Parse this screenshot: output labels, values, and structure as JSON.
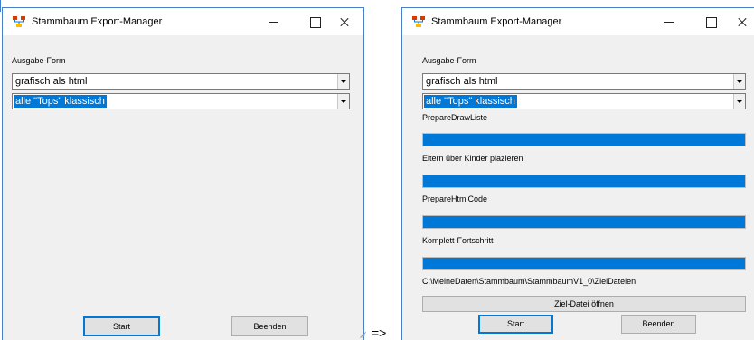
{
  "transition": {
    "arrow": "=>"
  },
  "colors": {
    "accent": "#0078d7",
    "window_border": "#4a7fc8",
    "titlebar": "#ffffff",
    "client": "#f0f0f0"
  },
  "icons": {
    "app": "family-tree-app-icon",
    "minimize": "minimize-icon",
    "maximize": "maximize-icon",
    "close": "close-icon",
    "dropdown": "chevron-down-icon",
    "grip": "resize-grip-icon"
  },
  "left": {
    "title": "Stammbaum Export-Manager",
    "output_label": "Ausgabe-Form",
    "combo_format": {
      "value": "grafisch als html"
    },
    "combo_tops": {
      "value": "alle \"Tops\" klassisch"
    },
    "start_label": "Start",
    "quit_label": "Beenden"
  },
  "right": {
    "title": "Stammbaum Export-Manager",
    "output_label": "Ausgabe-Form",
    "combo_format": {
      "value": "grafisch als html"
    },
    "combo_tops": {
      "value": "alle \"Tops\" klassisch"
    },
    "progress": [
      {
        "label": "PrepareDrawListe",
        "percent": 100
      },
      {
        "label": "Eltern über Kinder plazieren",
        "percent": 100
      },
      {
        "label": "PrepareHtmlCode",
        "percent": 100
      },
      {
        "label": "Komplett-Fortschritt",
        "percent": 100
      }
    ],
    "target_path": "C:\\MeineDaten\\Stammbaum\\StammbaumV1_0\\ZielDateien",
    "open_target_label": "Ziel-Datei öffnen",
    "start_label": "Start",
    "quit_label": "Beenden"
  }
}
